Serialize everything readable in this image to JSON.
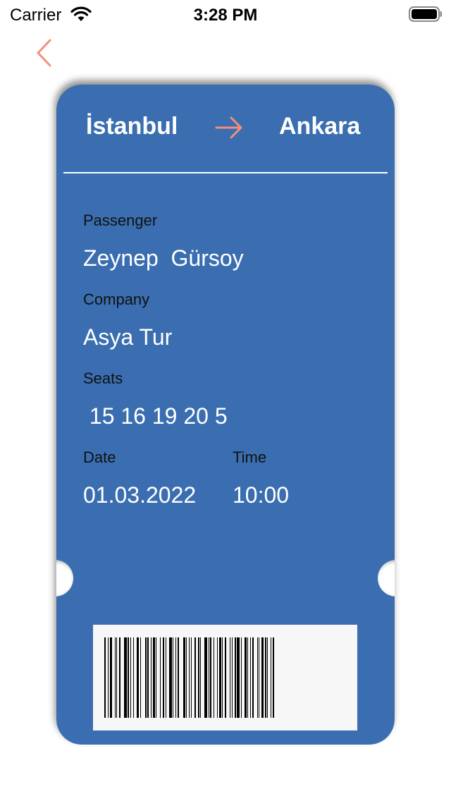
{
  "status_bar": {
    "carrier": "Carrier",
    "time": "3:28 PM"
  },
  "colors": {
    "ticket": "#3a6eb0",
    "accent": "#f0907a",
    "text_on_ticket": "#ffffff"
  },
  "icons": {
    "back": "chevron-left-icon",
    "arrow": "arrow-right-icon",
    "wifi": "wifi-icon",
    "battery": "battery-icon"
  },
  "ticket": {
    "from": "İstanbul",
    "to": "Ankara",
    "passenger_label": "Passenger",
    "passenger": "Zeynep  Gürsoy",
    "company_label": "Company",
    "company": "Asya Tur",
    "seats_label": "Seats",
    "seats": " 15 16 19 20 5",
    "date_label": "Date",
    "date": "01.03.2022",
    "time_label": "Time",
    "time": "10:00"
  }
}
